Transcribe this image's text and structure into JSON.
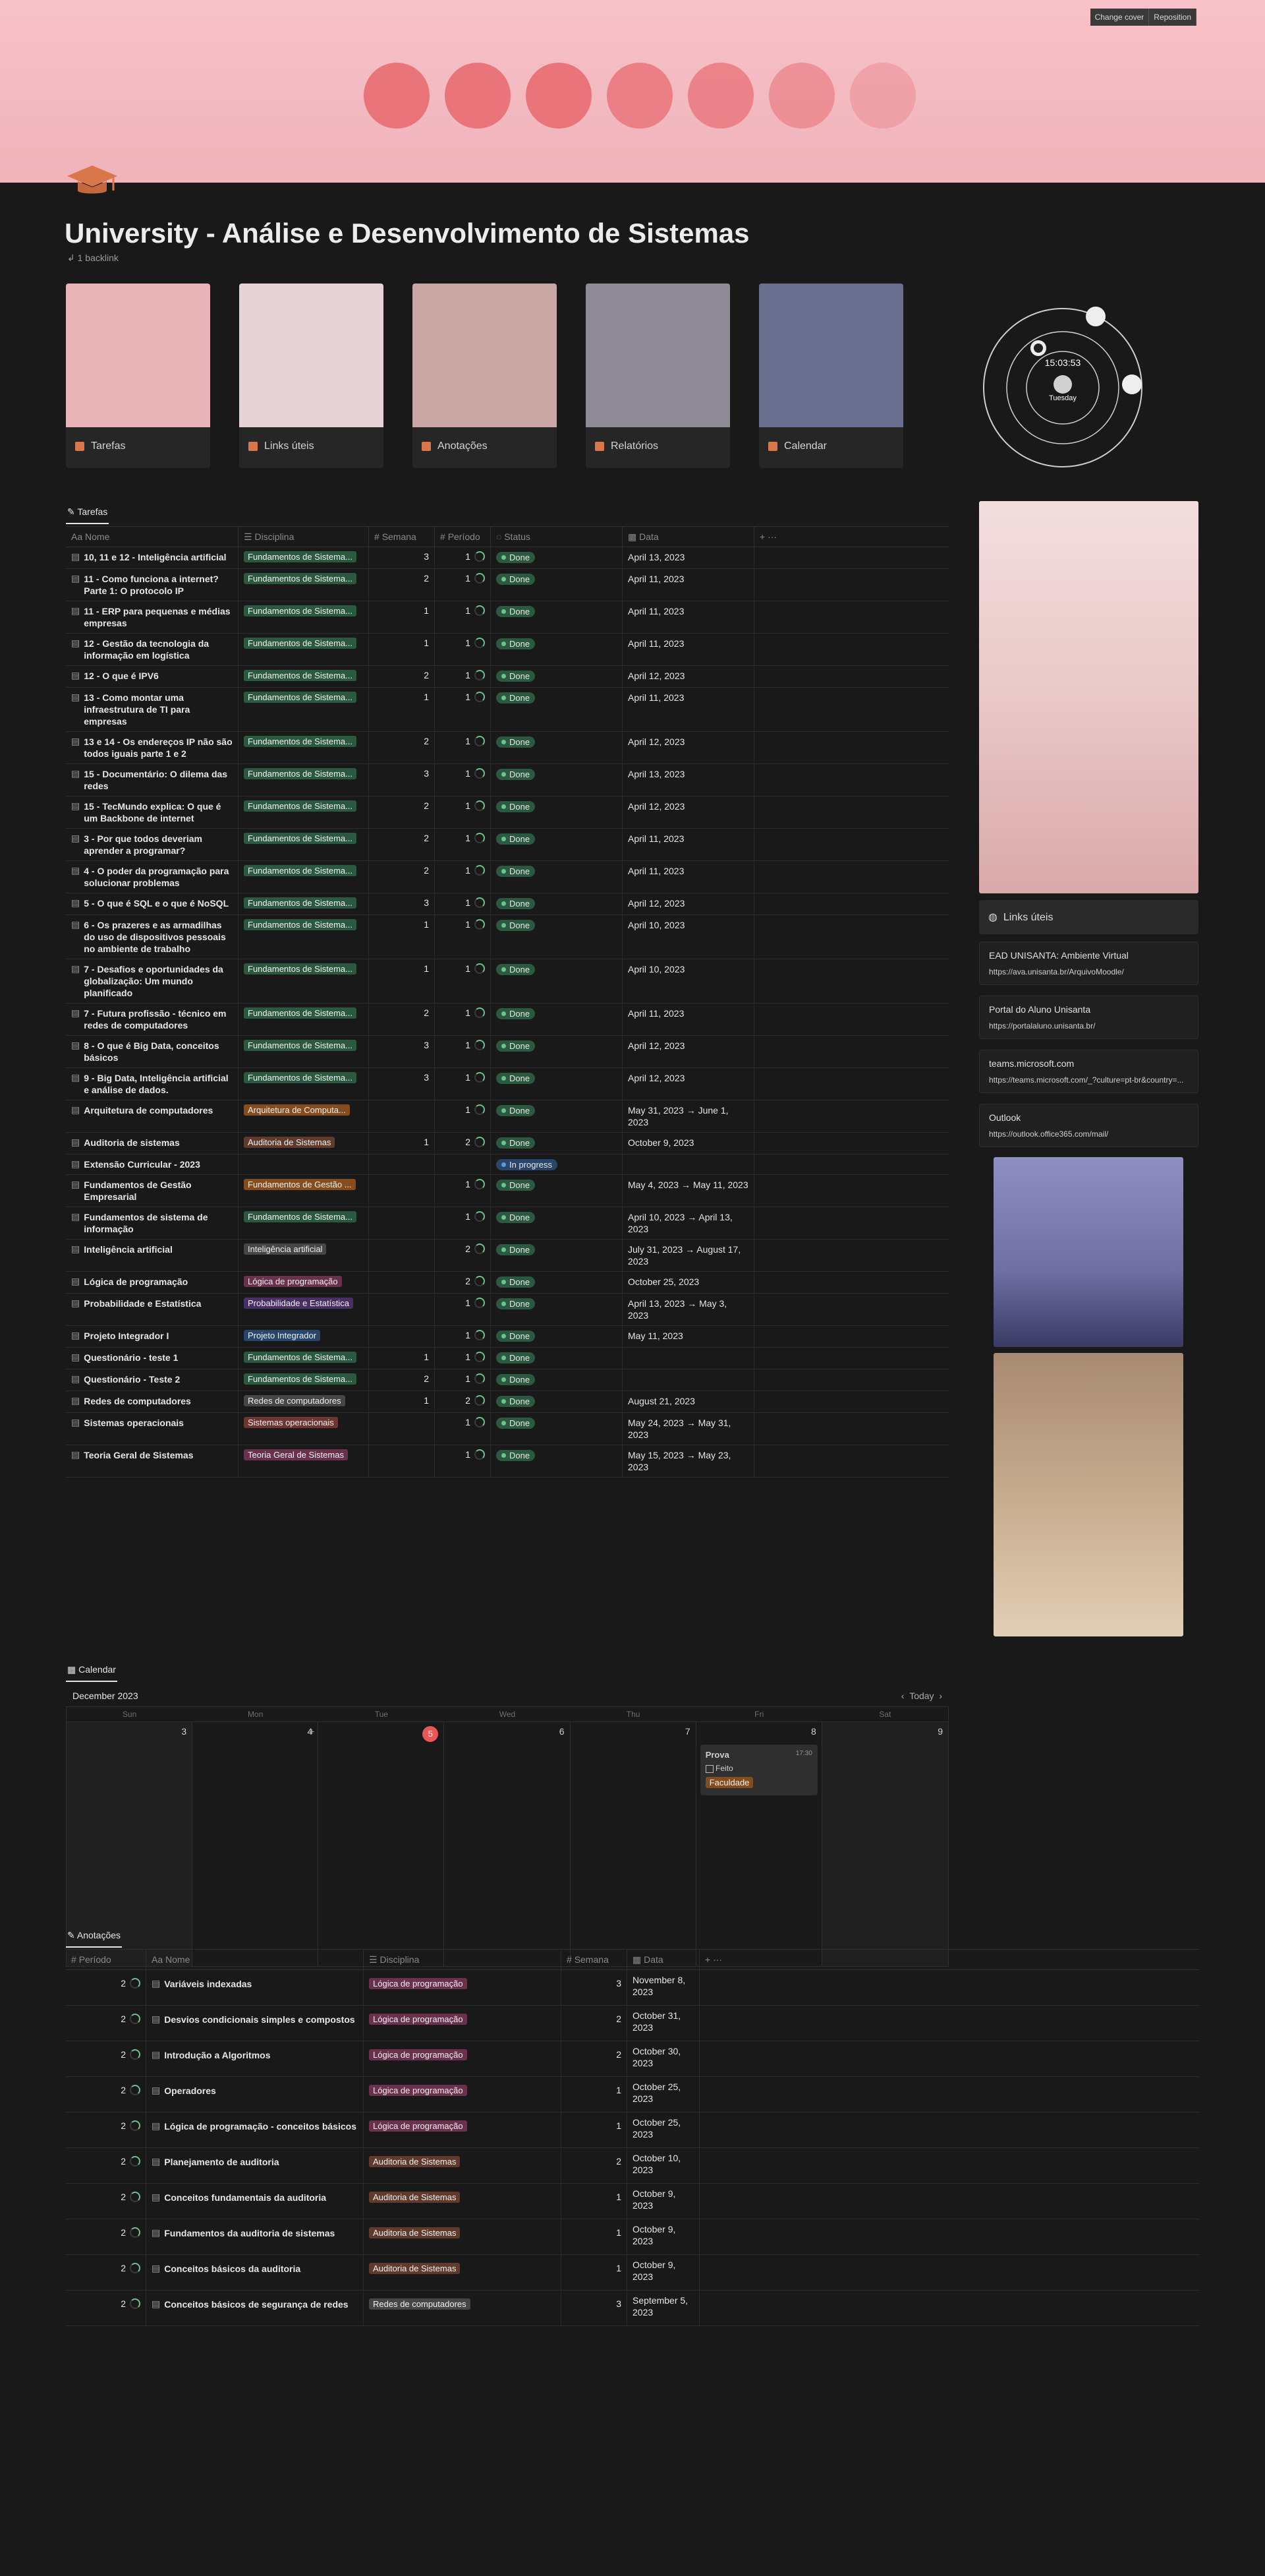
{
  "cover": {
    "change_label": "Change cover",
    "reposition_label": "Reposition"
  },
  "title": "University - Análise e Desenvolvimento de Sistemas",
  "backlink": "1 backlink",
  "cards": [
    {
      "label": "Tarefas",
      "color": "#e8b4b8"
    },
    {
      "label": "Links úteis",
      "color": "#e6d3d6"
    },
    {
      "label": "Anotações",
      "color": "#c9a7a4"
    },
    {
      "label": "Relatórios",
      "color": "#8f8b96"
    },
    {
      "label": "Calendar",
      "color": "#6b6f8f"
    }
  ],
  "clock": {
    "time": "15:03:53",
    "day": "Tuesday"
  },
  "tasks": {
    "tab": "Tarefas",
    "columns": [
      "Nome",
      "Disciplina",
      "Semana",
      "Período",
      "Status",
      "Data"
    ],
    "rows": [
      {
        "name": "10, 11 e 12 - Inteligência artificial",
        "tag": "Fundamentos de Sistema...",
        "tc": "t-green",
        "sem": "3",
        "per": "1",
        "status": "Done",
        "date": "April 13, 2023"
      },
      {
        "name": "11 - Como funciona a internet? Parte 1: O protocolo IP",
        "tag": "Fundamentos de Sistema...",
        "tc": "t-green",
        "sem": "2",
        "per": "1",
        "status": "Done",
        "date": "April 11, 2023"
      },
      {
        "name": "11 - ERP para pequenas e médias empresas",
        "tag": "Fundamentos de Sistema...",
        "tc": "t-green",
        "sem": "1",
        "per": "1",
        "status": "Done",
        "date": "April 11, 2023"
      },
      {
        "name": "12 - Gestão da tecnologia da informação em logística",
        "tag": "Fundamentos de Sistema...",
        "tc": "t-green",
        "sem": "1",
        "per": "1",
        "status": "Done",
        "date": "April 11, 2023"
      },
      {
        "name": "12 - O que é IPV6",
        "tag": "Fundamentos de Sistema...",
        "tc": "t-green",
        "sem": "2",
        "per": "1",
        "status": "Done",
        "date": "April 12, 2023"
      },
      {
        "name": "13 - Como montar uma infraestrutura de TI para empresas",
        "tag": "Fundamentos de Sistema...",
        "tc": "t-green",
        "sem": "1",
        "per": "1",
        "status": "Done",
        "date": "April 11, 2023"
      },
      {
        "name": "13 e 14 - Os endereços IP não são todos iguais parte 1 e 2",
        "tag": "Fundamentos de Sistema...",
        "tc": "t-green",
        "sem": "2",
        "per": "1",
        "status": "Done",
        "date": "April 12, 2023"
      },
      {
        "name": "15 - Documentário: O dilema das redes",
        "tag": "Fundamentos de Sistema...",
        "tc": "t-green",
        "sem": "3",
        "per": "1",
        "status": "Done",
        "date": "April 13, 2023"
      },
      {
        "name": "15 - TecMundo explica: O que é um Backbone de internet",
        "tag": "Fundamentos de Sistema...",
        "tc": "t-green",
        "sem": "2",
        "per": "1",
        "status": "Done",
        "date": "April 12, 2023"
      },
      {
        "name": "3 - Por que todos deveriam aprender a programar?",
        "tag": "Fundamentos de Sistema...",
        "tc": "t-green",
        "sem": "2",
        "per": "1",
        "status": "Done",
        "date": "April 11, 2023"
      },
      {
        "name": "4 - O poder da programação para solucionar problemas",
        "tag": "Fundamentos de Sistema...",
        "tc": "t-green",
        "sem": "2",
        "per": "1",
        "status": "Done",
        "date": "April 11, 2023"
      },
      {
        "name": "5 - O que é SQL e o que é NoSQL",
        "tag": "Fundamentos de Sistema...",
        "tc": "t-green",
        "sem": "3",
        "per": "1",
        "status": "Done",
        "date": "April 12, 2023"
      },
      {
        "name": "6 - Os prazeres e as armadilhas do uso de dispositivos pessoais no ambiente de trabalho",
        "tag": "Fundamentos de Sistema...",
        "tc": "t-green",
        "sem": "1",
        "per": "1",
        "status": "Done",
        "date": "April 10, 2023"
      },
      {
        "name": "7 - Desafios e oportunidades da globalização: Um mundo planificado",
        "tag": "Fundamentos de Sistema...",
        "tc": "t-green",
        "sem": "1",
        "per": "1",
        "status": "Done",
        "date": "April 10, 2023"
      },
      {
        "name": "7 - Futura profissão - técnico em redes de computadores",
        "tag": "Fundamentos de Sistema...",
        "tc": "t-green",
        "sem": "2",
        "per": "1",
        "status": "Done",
        "date": "April 11, 2023"
      },
      {
        "name": "8 - O que é Big Data, conceitos básicos",
        "tag": "Fundamentos de Sistema...",
        "tc": "t-green",
        "sem": "3",
        "per": "1",
        "status": "Done",
        "date": "April 12, 2023"
      },
      {
        "name": "9 - Big Data, Inteligência artificial e análise de dados.",
        "tag": "Fundamentos de Sistema...",
        "tc": "t-green",
        "sem": "3",
        "per": "1",
        "status": "Done",
        "date": "April 12, 2023"
      },
      {
        "name": "Arquitetura de computadores",
        "tag": "Arquitetura de Computa...",
        "tc": "t-orange",
        "sem": "",
        "per": "1",
        "status": "Done",
        "date": "May 31, 2023 → June 1, 2023"
      },
      {
        "name": "Auditoria de sistemas",
        "tag": "Auditoria de Sistemas",
        "tc": "t-brown",
        "sem": "1",
        "per": "2",
        "status": "Done",
        "date": "October 9, 2023"
      },
      {
        "name": "Extensão Curricular - 2023",
        "tag": "",
        "tc": "",
        "sem": "",
        "per": "",
        "status": "In progress",
        "date": ""
      },
      {
        "name": "Fundamentos de Gestão Empresarial",
        "tag": "Fundamentos de Gestão ...",
        "tc": "t-orange",
        "sem": "",
        "per": "1",
        "status": "Done",
        "date": "May 4, 2023 → May 11, 2023"
      },
      {
        "name": "Fundamentos de sistema de informação",
        "tag": "Fundamentos de Sistema...",
        "tc": "t-green",
        "sem": "",
        "per": "1",
        "status": "Done",
        "date": "April 10, 2023 → April 13, 2023"
      },
      {
        "name": "Inteligência artificial",
        "tag": "Inteligência artificial",
        "tc": "t-gray",
        "sem": "",
        "per": "2",
        "status": "Done",
        "date": "July 31, 2023 → August 17, 2023"
      },
      {
        "name": "Lógica de programação",
        "tag": "Lógica de programação",
        "tc": "t-pink",
        "sem": "",
        "per": "2",
        "status": "Done",
        "date": "October 25, 2023"
      },
      {
        "name": "Probabilidade e Estatística",
        "tag": "Probabilidade e Estatística",
        "tc": "t-purple",
        "sem": "",
        "per": "1",
        "status": "Done",
        "date": "April 13, 2023 → May 3, 2023"
      },
      {
        "name": "Projeto Integrador I",
        "tag": "Projeto Integrador",
        "tc": "t-blue",
        "sem": "",
        "per": "1",
        "status": "Done",
        "date": "May 11, 2023"
      },
      {
        "name": "Questionário - teste 1",
        "tag": "Fundamentos de Sistema...",
        "tc": "t-green",
        "sem": "1",
        "per": "1",
        "status": "Done",
        "date": ""
      },
      {
        "name": "Questionário - Teste 2",
        "tag": "Fundamentos de Sistema...",
        "tc": "t-green",
        "sem": "2",
        "per": "1",
        "status": "Done",
        "date": ""
      },
      {
        "name": "Redes de computadores",
        "tag": "Redes de computadores",
        "tc": "t-gray",
        "sem": "1",
        "per": "2",
        "status": "Done",
        "date": "August 21, 2023"
      },
      {
        "name": "Sistemas operacionais",
        "tag": "Sistemas operacionais",
        "tc": "t-red",
        "sem": "",
        "per": "1",
        "status": "Done",
        "date": "May 24, 2023 → May 31, 2023"
      },
      {
        "name": "Teoria Geral de Sistemas",
        "tag": "Teoria Geral de Sistemas",
        "tc": "t-pink",
        "sem": "",
        "per": "1",
        "status": "Done",
        "date": "May 15, 2023 → May 23, 2023"
      }
    ]
  },
  "links": {
    "title": "Links úteis",
    "items": [
      {
        "title": "EAD UNISANTA: Ambiente Virtual",
        "url": "https://ava.unisanta.br/ArquivoMoodle/"
      },
      {
        "title": "Portal do Aluno Unisanta",
        "url": "https://portalaluno.unisanta.br/"
      },
      {
        "title": "teams.microsoft.com",
        "url": "https://teams.microsoft.com/_?culture=pt-br&country=..."
      },
      {
        "title": "Outlook",
        "url": "https://outlook.office365.com/mail/"
      }
    ]
  },
  "calendar": {
    "tab": "Calendar",
    "month": "December 2023",
    "today_label": "Today",
    "weekdays": [
      "Sun",
      "Mon",
      "Tue",
      "Wed",
      "Thu",
      "Fri",
      "Sat"
    ],
    "days": [
      "3",
      "4",
      "5",
      "6",
      "7",
      "8",
      "9"
    ],
    "event": {
      "title": "Prova",
      "time": "17:30",
      "check": "Feito",
      "tag": "Faculdade"
    }
  },
  "notes": {
    "tab": "Anotações",
    "columns": [
      "Período",
      "Nome",
      "Disciplina",
      "Semana",
      "Data"
    ],
    "rows": [
      {
        "per": "2",
        "name": "Variáveis indexadas",
        "tag": "Lógica de programação",
        "tc": "t-pink",
        "sem": "3",
        "date": "November 8, 2023"
      },
      {
        "per": "2",
        "name": "Desvios condicionais simples e compostos",
        "tag": "Lógica de programação",
        "tc": "t-pink",
        "sem": "2",
        "date": "October 31, 2023"
      },
      {
        "per": "2",
        "name": "Introdução a Algoritmos",
        "tag": "Lógica de programação",
        "tc": "t-pink",
        "sem": "2",
        "date": "October 30, 2023"
      },
      {
        "per": "2",
        "name": "Operadores",
        "tag": "Lógica de programação",
        "tc": "t-pink",
        "sem": "1",
        "date": "October 25, 2023"
      },
      {
        "per": "2",
        "name": "Lógica de programação - conceitos básicos",
        "tag": "Lógica de programação",
        "tc": "t-pink",
        "sem": "1",
        "date": "October 25, 2023"
      },
      {
        "per": "2",
        "name": "Planejamento de auditoria",
        "tag": "Auditoria de Sistemas",
        "tc": "t-brown",
        "sem": "2",
        "date": "October 10, 2023"
      },
      {
        "per": "2",
        "name": "Conceitos fundamentais da auditoria",
        "tag": "Auditoria de Sistemas",
        "tc": "t-brown",
        "sem": "1",
        "date": "October 9, 2023"
      },
      {
        "per": "2",
        "name": "Fundamentos da auditoria de sistemas",
        "tag": "Auditoria de Sistemas",
        "tc": "t-brown",
        "sem": "1",
        "date": "October 9, 2023"
      },
      {
        "per": "2",
        "name": "Conceitos básicos da auditoria",
        "tag": "Auditoria de Sistemas",
        "tc": "t-brown",
        "sem": "1",
        "date": "October 9, 2023"
      },
      {
        "per": "2",
        "name": "Conceitos básicos de segurança de redes",
        "tag": "Redes de computadores",
        "tc": "t-gray",
        "sem": "3",
        "date": "September 5, 2023"
      }
    ]
  }
}
